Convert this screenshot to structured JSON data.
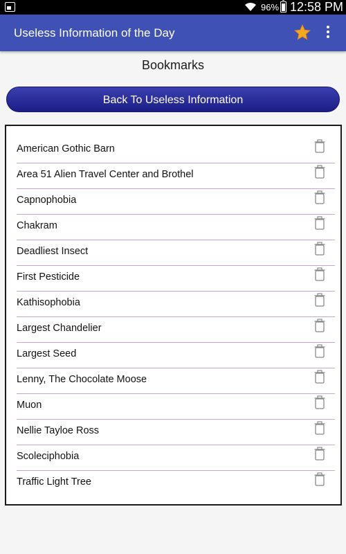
{
  "status_bar": {
    "battery_percent": "96%",
    "time": "12:58 PM",
    "icons": [
      "screenshot-icon",
      "wifi-icon",
      "battery-icon"
    ]
  },
  "app_bar": {
    "title": "Useless Information of the Day",
    "icons": [
      "star-icon",
      "more-vert-icon"
    ],
    "background_color": "#3f51b5",
    "star_color": "#f5a623"
  },
  "page": {
    "heading": "Bookmarks",
    "back_button_label": "Back To Useless Information",
    "back_button_color": "#2a2ca0",
    "divider_color": "#c9a3d6"
  },
  "bookmarks": [
    "American Gothic Barn",
    "Area 51 Alien Travel Center and Brothel",
    "Capnophobia",
    "Chakram",
    "Deadliest Insect",
    "First Pesticide",
    "Kathisophobia",
    "Largest Chandelier",
    "Largest Seed",
    "Lenny, The Chocolate Moose",
    "Muon",
    "Nellie Tayloe Ross",
    "Scoleciphobia",
    "Traffic Light Tree"
  ],
  "item_icon": "trash-icon"
}
